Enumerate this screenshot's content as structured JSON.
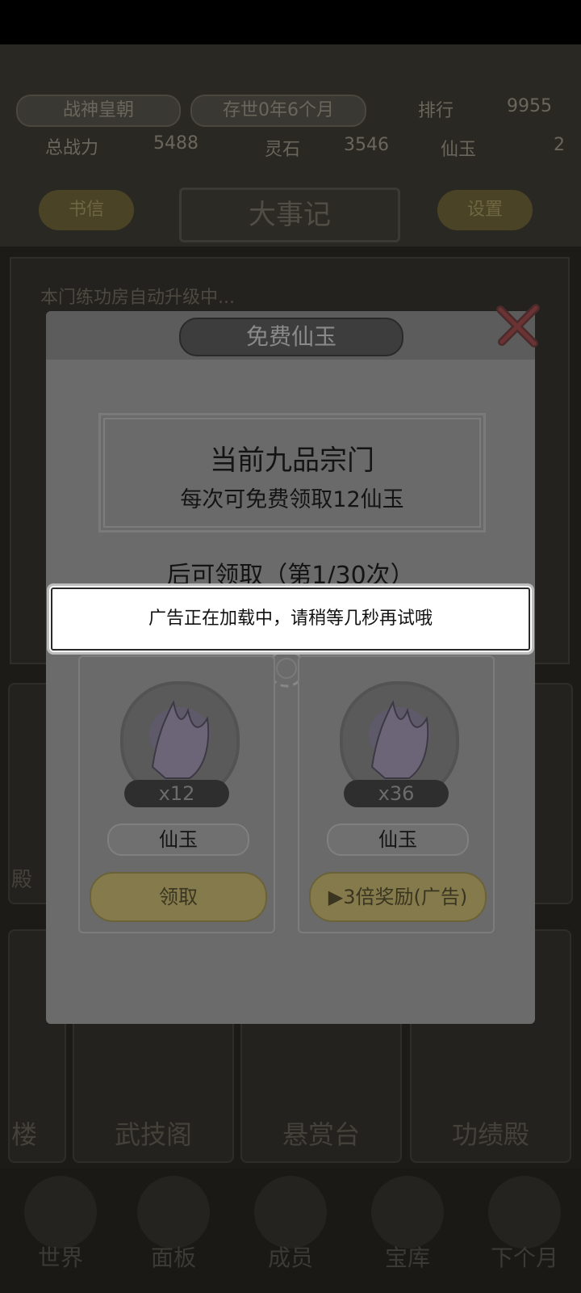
{
  "header": {
    "sect_name": "战神皇朝",
    "survival": "存世0年6个月",
    "rank_label": "排行",
    "rank_value": "9955",
    "power_label": "总战力",
    "power_value": "5488",
    "spirit_stone_label": "灵石",
    "spirit_stone_value": "3546",
    "jade_label": "仙玉",
    "jade_value": "2",
    "mail_button": "书信",
    "section_title": "大事记",
    "settings_button": "设置"
  },
  "log": {
    "first_line": "本门练功房自动升级中..."
  },
  "buildings": [
    {
      "label": "殿"
    },
    {
      "label": "楼"
    },
    {
      "label": "武技阁"
    },
    {
      "label": "悬赏台"
    },
    {
      "label": "功绩殿"
    }
  ],
  "nav": [
    {
      "label": "世界"
    },
    {
      "label": "面板"
    },
    {
      "label": "成员"
    },
    {
      "label": "宝库"
    },
    {
      "label": "下个月"
    }
  ],
  "modal": {
    "title": "免费仙玉",
    "info_title": "当前九品宗门",
    "info_sub": "每次可免费领取12仙玉",
    "countdown": "后可领取（第1/30次）",
    "cards": [
      {
        "qty": "x12",
        "name": "仙玉",
        "button": "领取"
      },
      {
        "qty": "x36",
        "name": "仙玉",
        "button": "▶3倍奖励(广告)"
      }
    ]
  },
  "toast": {
    "message": "广告正在加载中，请稍等几秒再试哦"
  },
  "colors": {
    "overlay_dim": "#000000",
    "toast_bg": "#ffffff",
    "claim_button": "#847a4b"
  }
}
